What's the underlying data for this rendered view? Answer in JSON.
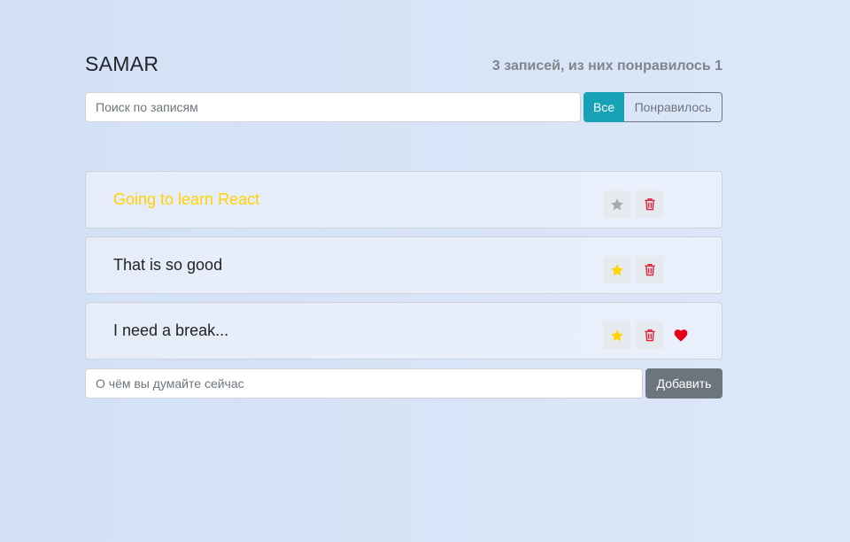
{
  "header": {
    "title": "SAMAR",
    "stats": "3 записей, из них понравилось 1"
  },
  "search": {
    "placeholder": "Поиск по записям",
    "value": ""
  },
  "filter": {
    "all_label": "Все",
    "liked_label": "Понравилось",
    "active": "all"
  },
  "posts": [
    {
      "label": "Going to learn React",
      "important": true,
      "like": false,
      "star_icon": "star-icon",
      "delete_icon": "trash-icon"
    },
    {
      "label": "That is so good",
      "important": false,
      "like": false,
      "star_icon": "star-icon",
      "delete_icon": "trash-icon"
    },
    {
      "label": "I need a break...",
      "important": false,
      "like": true,
      "star_icon": "star-icon",
      "delete_icon": "trash-icon",
      "like_icon": "heart-icon"
    }
  ],
  "add_form": {
    "placeholder": "О чём вы думайте сейчас",
    "value": "",
    "submit_label": "Добавить"
  },
  "colors": {
    "accent": "#17a2b8",
    "secondary": "#6c757d",
    "important_text": "#ffd200",
    "star_active": "#ffd200",
    "star_inactive": "#a7abb0",
    "trash": "#e0243a",
    "heart": "#e4001b"
  }
}
